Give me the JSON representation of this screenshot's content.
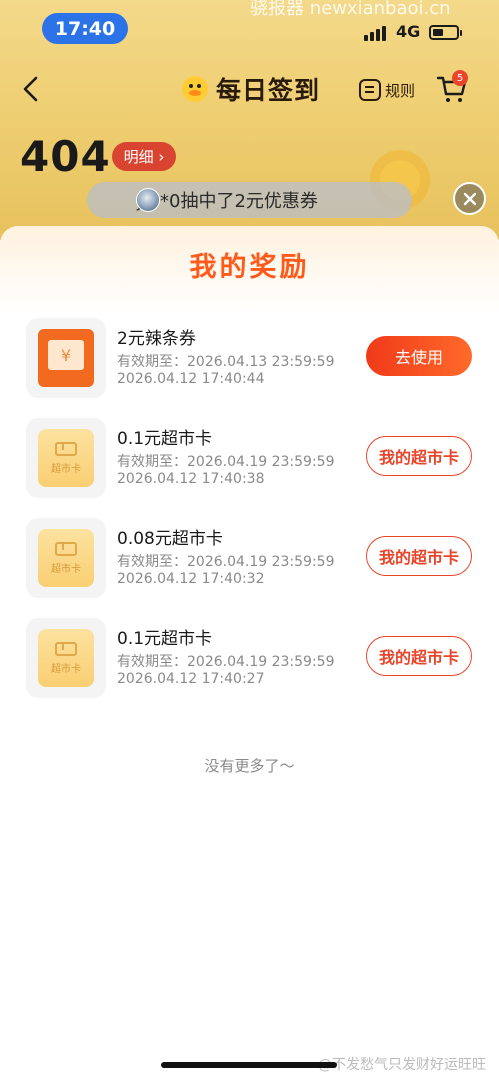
{
  "watermark_top": "骁报器 newxianbaoi.cn",
  "status_bar": {
    "time": "17:40",
    "network": "4G"
  },
  "header": {
    "title": "每日签到",
    "rules_label": "规则",
    "cart_badge": "5"
  },
  "points": {
    "value": "404",
    "detail_label": "明细 ›"
  },
  "ticker": {
    "text": "j***0抽中了2元优惠券"
  },
  "sheet": {
    "title": "我的奖励",
    "items": [
      {
        "title": "2元辣条券",
        "expiry": "有效期至：2026.04.13 23:59:59",
        "time": "2026.04.12 17:40:44",
        "button": "去使用",
        "thumb": "coupon"
      },
      {
        "title": "0.1元超市卡",
        "expiry": "有效期至：2026.04.19 23:59:59",
        "time": "2026.04.12 17:40:38",
        "button": "我的超市卡",
        "thumb": "card",
        "thumb_label": "超市卡"
      },
      {
        "title": "0.08元超市卡",
        "expiry": "有效期至：2026.04.19 23:59:59",
        "time": "2026.04.12 17:40:32",
        "button": "我的超市卡",
        "thumb": "card",
        "thumb_label": "超市卡"
      },
      {
        "title": "0.1元超市卡",
        "expiry": "有效期至：2026.04.19 23:59:59",
        "time": "2026.04.12 17:40:27",
        "button": "我的超市卡",
        "thumb": "card",
        "thumb_label": "超市卡"
      }
    ],
    "coupon_symbol": "¥",
    "no_more": "没有更多了～"
  },
  "watermark_bottom": "@不发愁气只发财好运旺旺",
  "colors": {
    "accent": "#e8452a",
    "title_orange": "#ff5a1a",
    "status_pill": "#2c73e8",
    "header_bg": "#efcf73"
  }
}
